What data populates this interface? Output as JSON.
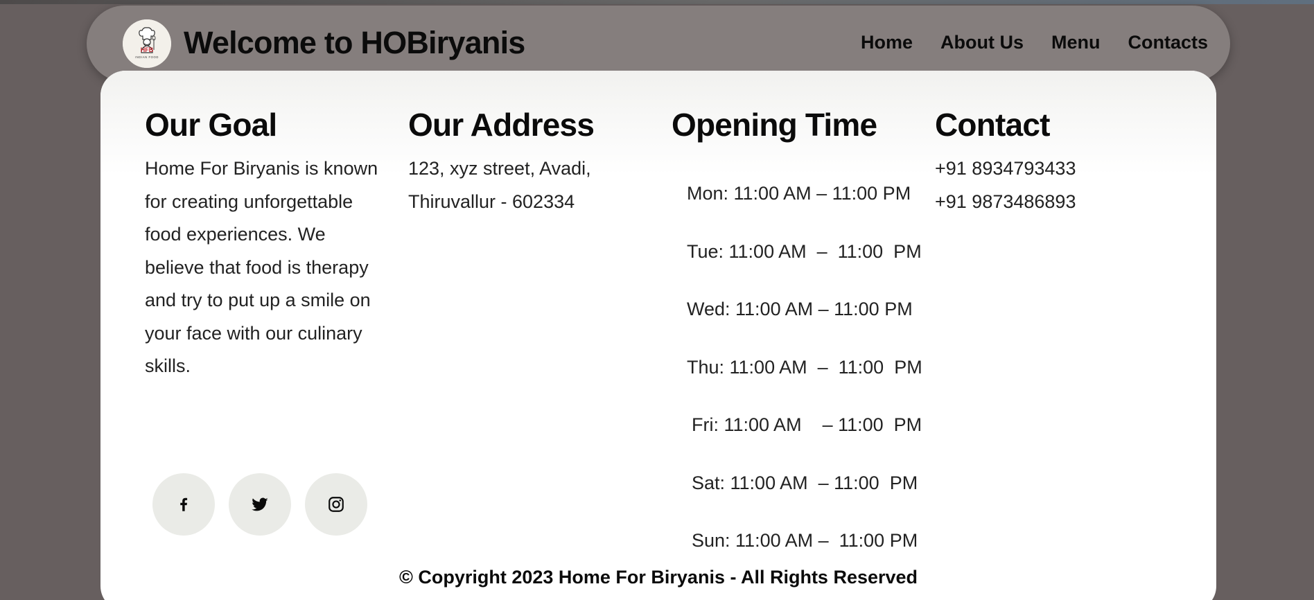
{
  "header": {
    "title": "Welcome to HOBiryanis",
    "logo_text": "INDIAN FOOD",
    "nav": [
      {
        "label": "Home"
      },
      {
        "label": "About Us"
      },
      {
        "label": "Menu"
      },
      {
        "label": "Contacts"
      }
    ]
  },
  "goal": {
    "heading": "Our Goal",
    "text": "Home For Biryanis is known for creating unforgettable food experiences. We believe that food is therapy and try to put up a smile on your face with our culinary skills."
  },
  "address": {
    "heading": "Our Address",
    "lines": [
      "123, xyz street, Avadi,",
      "Thiruvallur - 602334"
    ]
  },
  "hours": {
    "heading": "Opening Time",
    "lines": [
      "Mon: 11:00 AM – 11:00 PM",
      "Tue: 11:00 AM  –  11:00  PM",
      "Wed: 11:00 AM – 11:00 PM",
      "Thu: 11:00 AM  –  11:00  PM",
      "Fri: 11:00 AM    – 11:00  PM",
      "Sat: 11:00 AM  – 11:00  PM",
      "Sun: 11:00 AM –  11:00 PM"
    ]
  },
  "contact": {
    "heading": "Contact",
    "phones": [
      "+91 8934793433",
      "+91 9873486893"
    ]
  },
  "socials": [
    {
      "icon": "facebook-icon"
    },
    {
      "icon": "twitter-icon"
    },
    {
      "icon": "instagram-icon"
    }
  ],
  "footer": {
    "copyright": "© Copyright 2023 Home For Biryanis - All Rights Reserved"
  },
  "colors": {
    "page_bg": "#675f5f",
    "header_bg": "#857e7d",
    "card_bg": "#ffffff",
    "social_bg": "#eaebe7"
  }
}
